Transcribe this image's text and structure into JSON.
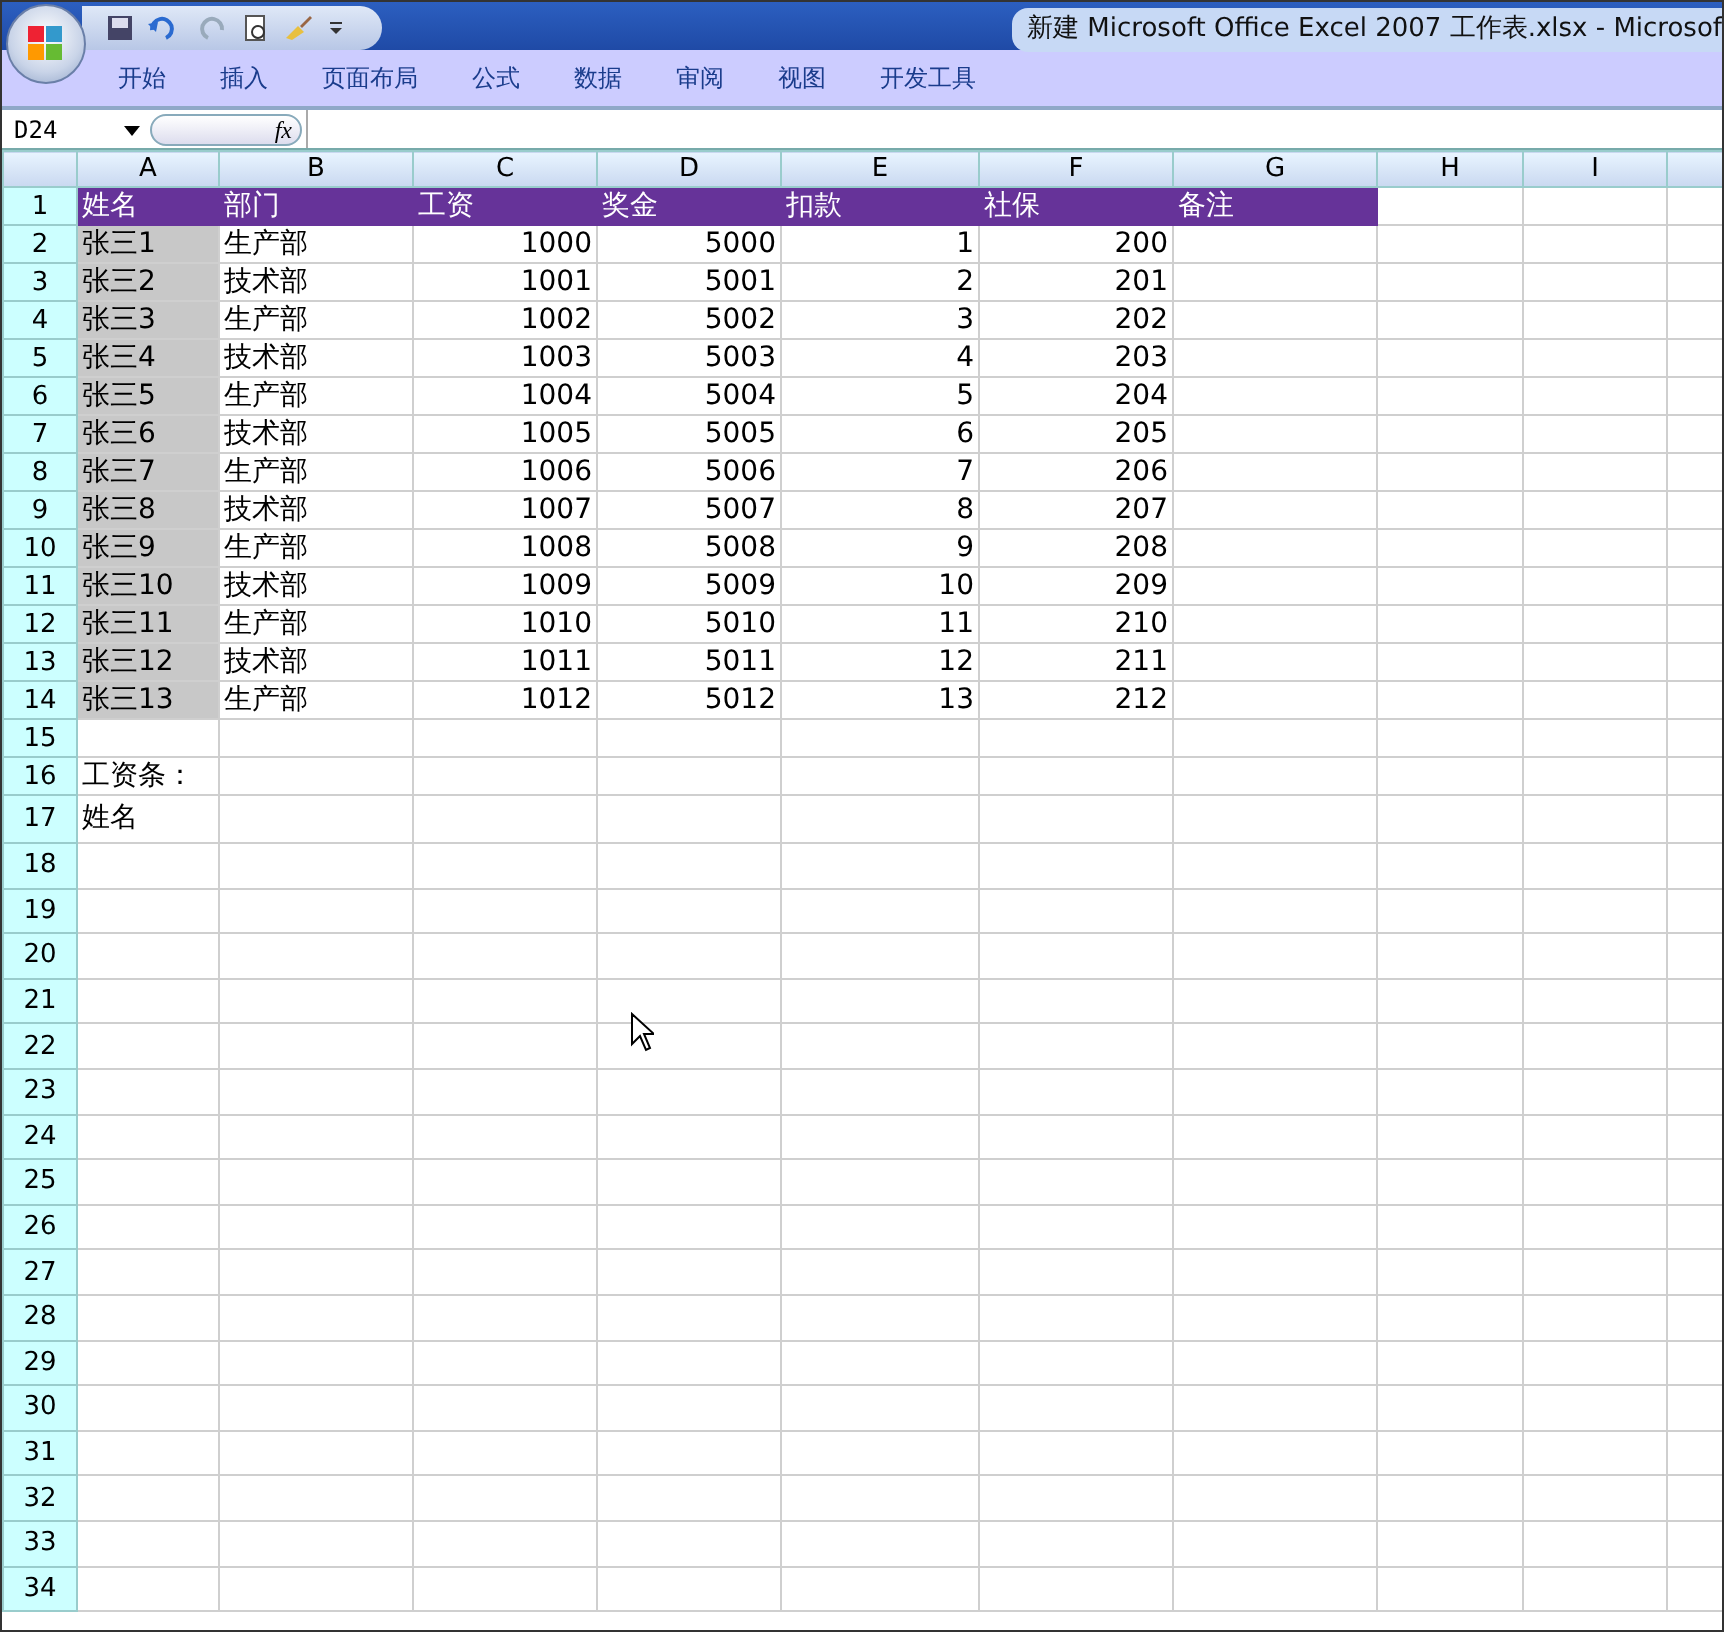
{
  "window": {
    "title": "新建 Microsoft Office Excel 2007 工作表.xlsx - Microsof"
  },
  "ribbon_tabs": [
    {
      "label": "开始"
    },
    {
      "label": "插入"
    },
    {
      "label": "页面布局"
    },
    {
      "label": "公式"
    },
    {
      "label": "数据"
    },
    {
      "label": "审阅"
    },
    {
      "label": "视图"
    },
    {
      "label": "开发工具"
    }
  ],
  "formula_bar": {
    "name_box": "D24",
    "fx": "fx"
  },
  "columns": [
    {
      "label": "A",
      "numeric": false
    },
    {
      "label": "B",
      "numeric": false
    },
    {
      "label": "C",
      "numeric": true
    },
    {
      "label": "D",
      "numeric": true
    },
    {
      "label": "E",
      "numeric": true
    },
    {
      "label": "F",
      "numeric": true
    },
    {
      "label": "G"
    },
    {
      "label": "H"
    },
    {
      "label": "I"
    }
  ],
  "rows": [
    {
      "number": "1",
      "kind": "header",
      "cells": [
        "姓名",
        "部门",
        "工资",
        "奖金",
        "扣款",
        "社保",
        "备注"
      ]
    },
    {
      "number": "2",
      "kind": "data",
      "cells": [
        "张三1",
        "生产部",
        "1000",
        "5000",
        "1",
        "200"
      ]
    },
    {
      "number": "3",
      "kind": "data",
      "cells": [
        "张三2",
        "技术部",
        "1001",
        "5001",
        "2",
        "201"
      ]
    },
    {
      "number": "4",
      "kind": "data",
      "cells": [
        "张三3",
        "生产部",
        "1002",
        "5002",
        "3",
        "202"
      ]
    },
    {
      "number": "5",
      "kind": "data",
      "cells": [
        "张三4",
        "技术部",
        "1003",
        "5003",
        "4",
        "203"
      ]
    },
    {
      "number": "6",
      "kind": "data",
      "cells": [
        "张三5",
        "生产部",
        "1004",
        "5004",
        "5",
        "204"
      ]
    },
    {
      "number": "7",
      "kind": "data",
      "cells": [
        "张三6",
        "技术部",
        "1005",
        "5005",
        "6",
        "205"
      ]
    },
    {
      "number": "8",
      "kind": "data",
      "cells": [
        "张三7",
        "生产部",
        "1006",
        "5006",
        "7",
        "206"
      ]
    },
    {
      "number": "9",
      "kind": "data",
      "cells": [
        "张三8",
        "技术部",
        "1007",
        "5007",
        "8",
        "207"
      ]
    },
    {
      "number": "10",
      "kind": "data",
      "cells": [
        "张三9",
        "生产部",
        "1008",
        "5008",
        "9",
        "208"
      ]
    },
    {
      "number": "11",
      "kind": "data",
      "cells": [
        "张三10",
        "技术部",
        "1009",
        "5009",
        "10",
        "209"
      ]
    },
    {
      "number": "12",
      "kind": "data",
      "cells": [
        "张三11",
        "生产部",
        "1010",
        "5010",
        "11",
        "210"
      ]
    },
    {
      "number": "13",
      "kind": "data",
      "cells": [
        "张三12",
        "技术部",
        "1011",
        "5011",
        "12",
        "211"
      ]
    },
    {
      "number": "14",
      "kind": "data",
      "cells": [
        "张三13",
        "生产部",
        "1012",
        "5012",
        "13",
        "212"
      ]
    },
    {
      "number": "15",
      "kind": "plain"
    },
    {
      "number": "16",
      "kind": "plain",
      "cells": [
        "工资条："
      ]
    },
    {
      "number": "17",
      "kind": "tall",
      "cells": [
        "姓名"
      ]
    },
    {
      "number": "18",
      "kind": "tall"
    },
    {
      "number": "19",
      "kind": "tall"
    },
    {
      "number": "20",
      "kind": "tall"
    },
    {
      "number": "21",
      "kind": "tall"
    },
    {
      "number": "22",
      "kind": "tall"
    },
    {
      "number": "23",
      "kind": "tall"
    },
    {
      "number": "24",
      "kind": "tall"
    },
    {
      "number": "25",
      "kind": "tall"
    },
    {
      "number": "26",
      "kind": "tall"
    },
    {
      "number": "27",
      "kind": "tall"
    },
    {
      "number": "28",
      "kind": "tall"
    },
    {
      "number": "29",
      "kind": "tall"
    },
    {
      "number": "30",
      "kind": "tall"
    },
    {
      "number": "31",
      "kind": "tall"
    },
    {
      "number": "32",
      "kind": "tall"
    },
    {
      "number": "33",
      "kind": "tall"
    },
    {
      "number": "34",
      "kind": "tall"
    }
  ]
}
